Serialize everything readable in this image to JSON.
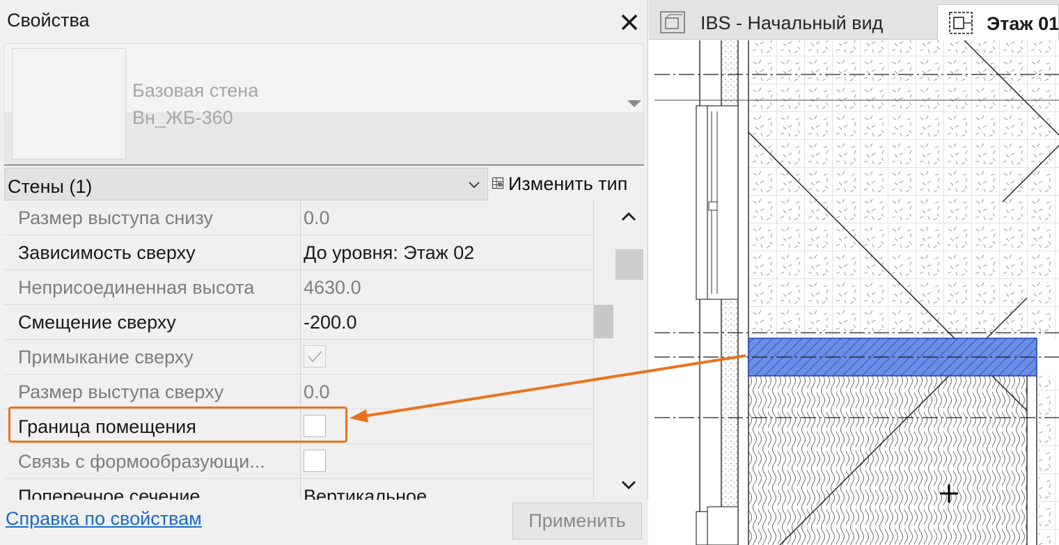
{
  "properties": {
    "title": "Свойства",
    "type_selector": {
      "family": "Базовая стена",
      "name": "Вн_ЖБ-360"
    },
    "filter": {
      "label": "Стены (1)"
    },
    "edit_type_label": "Изменить тип",
    "rows": [
      {
        "name": "Размер выступа снизу",
        "value": "0.0"
      },
      {
        "name": "Зависимость сверху",
        "value": "До уровня: Этаж 02"
      },
      {
        "name": "Неприсоединенная высота",
        "value": "4630.0"
      },
      {
        "name": "Смещение сверху",
        "value": "-200.0"
      },
      {
        "name": "Примыкание сверху",
        "checked": true
      },
      {
        "name": "Размер выступа сверху",
        "value": "0.0"
      },
      {
        "name": "Граница помещения",
        "checked": false
      },
      {
        "name": "Связь с формообразующи...",
        "checked": false
      },
      {
        "name": "Поперечное сечение",
        "value": "Вертикальное"
      }
    ],
    "help_link": "Справка по свойствам",
    "apply_label": "Применить"
  },
  "view": {
    "tabs": [
      {
        "label": "IBS - Начальный вид",
        "icon": "3d-view-icon"
      },
      {
        "label": "Этаж 01",
        "icon": "floor-plan-icon"
      }
    ]
  },
  "colors": {
    "highlight": "#e8731e",
    "selected_wall": "#6b8ee8",
    "link": "#1b6ac9"
  }
}
